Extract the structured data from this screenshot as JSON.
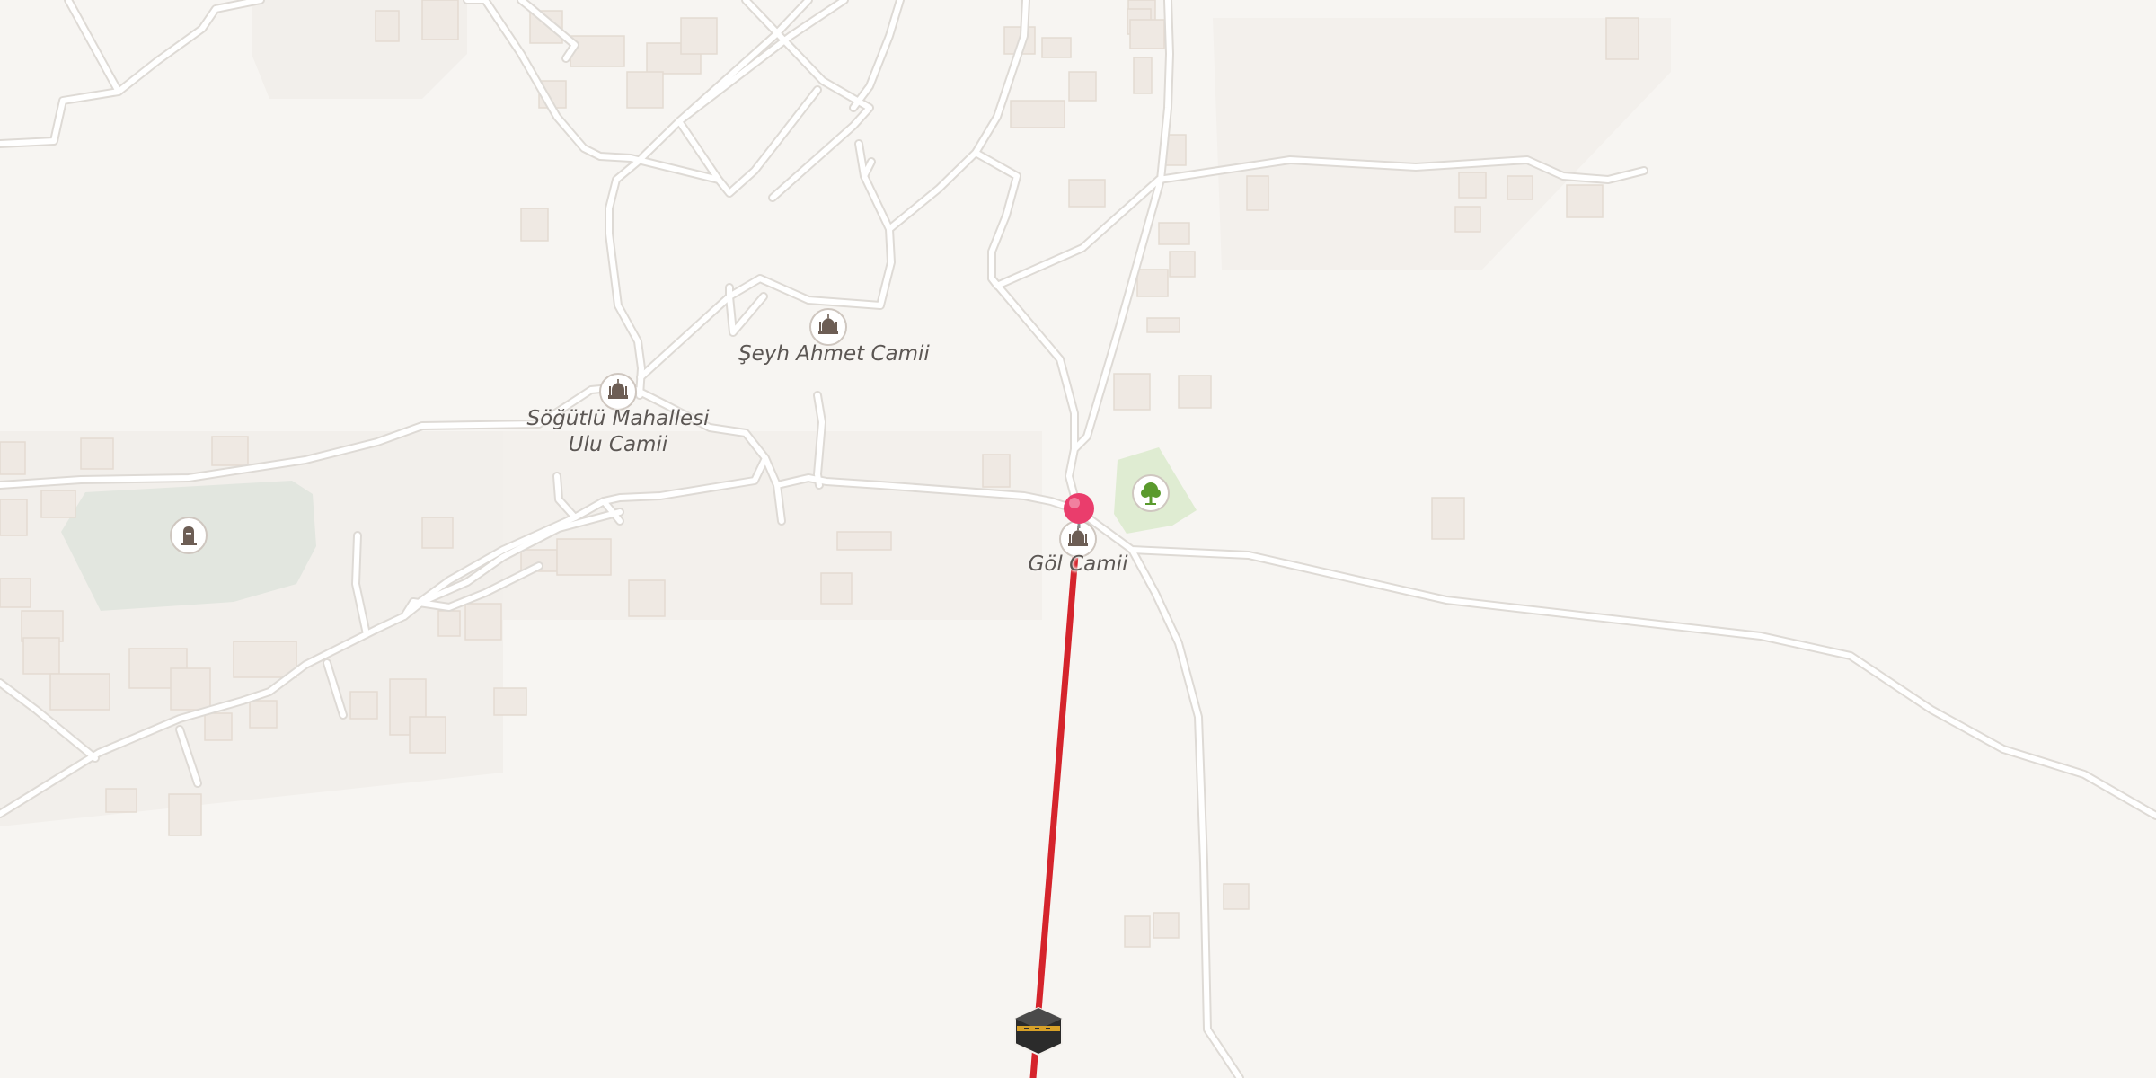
{
  "map": {
    "colors": {
      "background": "#f7f5f2",
      "road": "#ffffff",
      "road_casing": "#dedad5",
      "building": "#efe9e3",
      "cemetery": "#e2e6df",
      "park": "#dfecd2",
      "route": "#d5242c",
      "pin": "#ea3d6c",
      "label": "#5c5754"
    },
    "pois": [
      {
        "id": "seyh-ahmet",
        "type": "mosque",
        "icon": "mosque-icon",
        "name_lines": [
          "Şeyh Ahmet Camii"
        ]
      },
      {
        "id": "sogutlu",
        "type": "mosque",
        "icon": "mosque-icon",
        "name_lines": [
          "Söğütlü Mahallesi",
          "Ulu Camii"
        ]
      },
      {
        "id": "gol",
        "type": "mosque",
        "icon": "mosque-icon",
        "name_lines": [
          "Göl Camii"
        ]
      },
      {
        "id": "cemetery",
        "type": "cemetery",
        "icon": "tombstone-icon",
        "name_lines": []
      },
      {
        "id": "park",
        "type": "park",
        "icon": "tree-icon",
        "name_lines": []
      }
    ],
    "route": {
      "from": "location-pin-icon",
      "to": "kaaba-icon",
      "description": "Qibla direction line"
    }
  }
}
